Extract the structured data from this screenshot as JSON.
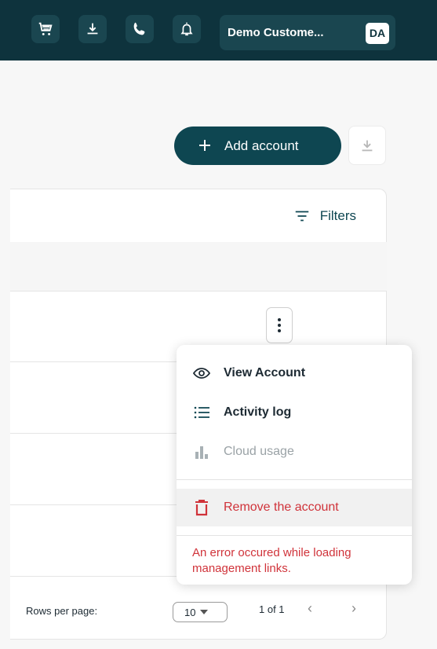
{
  "topbar": {
    "cart_icon": "cart-icon",
    "download_icon": "download-icon",
    "phone_icon": "phone-icon",
    "bell_icon": "bell-icon",
    "user_name": "Demo Custome...",
    "avatar_initials": "DA"
  },
  "actions": {
    "add_account_label": "Add account",
    "export_icon": "download-icon"
  },
  "table": {
    "filters_label": "Filters"
  },
  "row_menu": {
    "items": [
      {
        "label": "View Account",
        "icon": "eye-icon",
        "enabled": true
      },
      {
        "label": "Activity log",
        "icon": "list-icon",
        "enabled": true
      },
      {
        "label": "Cloud usage",
        "icon": "bar-chart-icon",
        "enabled": false
      },
      {
        "label": "Remove the account",
        "icon": "trash-icon",
        "enabled": true,
        "danger": true
      }
    ],
    "error_text": "An error occured while loading management links."
  },
  "pagination": {
    "rows_per_page_label": "Rows per page:",
    "rows_per_page_value": "10",
    "page_info": "1 of 1"
  },
  "colors": {
    "topbar": "#0e333d",
    "primary": "#0e4651",
    "danger": "#d0333a"
  }
}
